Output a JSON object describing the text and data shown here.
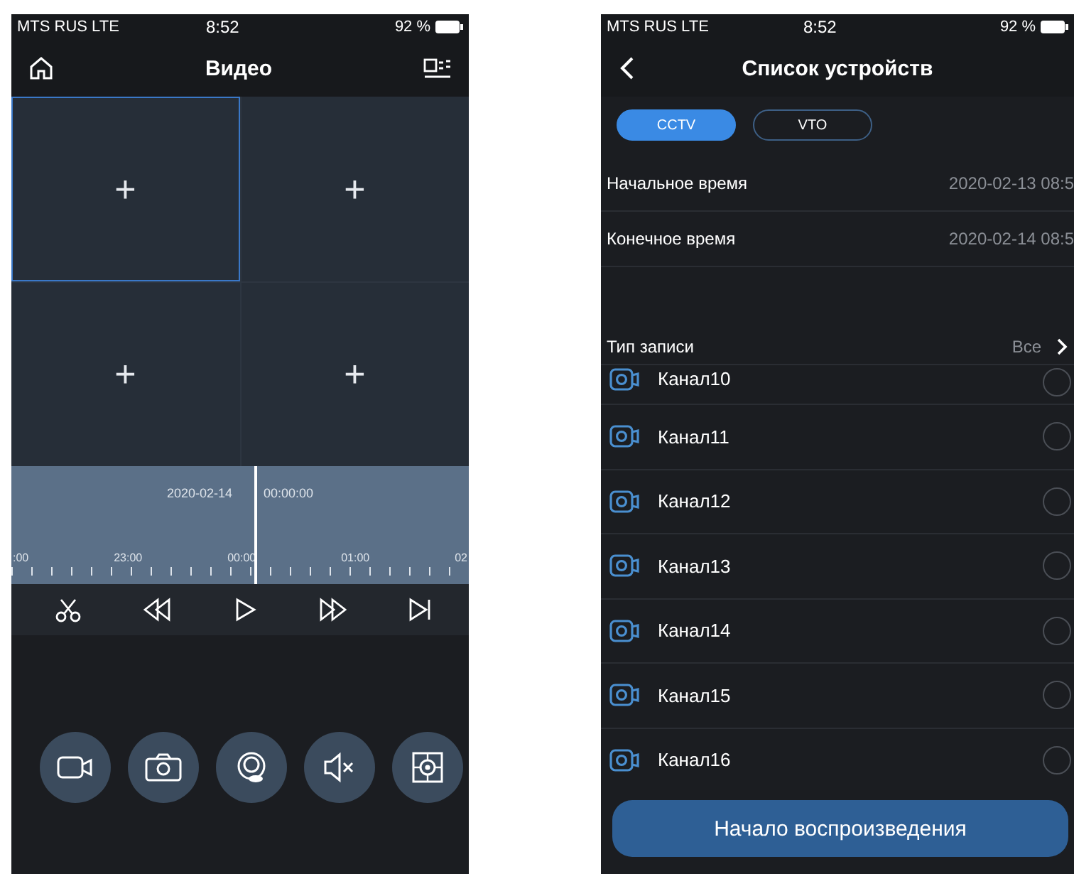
{
  "left_screen": {
    "status_bar": {
      "carrier": "MTS RUS  LTE",
      "time": "8:52",
      "battery": "92 %"
    },
    "header": {
      "title": "Видео"
    },
    "video_grid": [
      {
        "label": "+",
        "selected": true
      },
      {
        "label": "+",
        "selected": false
      },
      {
        "label": "+",
        "selected": false
      },
      {
        "label": "+",
        "selected": false
      }
    ],
    "timeline": {
      "date": "2020-02-14",
      "time": "00:00:00",
      "ticks": [
        ":00",
        "23:00",
        "00:00",
        "01:00",
        "02"
      ]
    },
    "playback_controls": [
      {
        "kind": "cut"
      },
      {
        "kind": "rewind"
      },
      {
        "kind": "play"
      },
      {
        "kind": "forward"
      },
      {
        "kind": "next"
      }
    ],
    "action_buttons": [
      {
        "kind": "record"
      },
      {
        "kind": "snapshot"
      },
      {
        "kind": "fisheye"
      },
      {
        "kind": "mute"
      },
      {
        "kind": "ptz"
      }
    ]
  },
  "right_screen": {
    "status_bar": {
      "carrier": "MTS RUS  LTE",
      "time": "8:52",
      "battery": "92 %"
    },
    "header": {
      "title": "Список устройств"
    },
    "tabs": [
      {
        "label": "CCTV",
        "selected": true
      },
      {
        "label": "VTO",
        "selected": false
      }
    ],
    "fields": [
      {
        "label": "Начальное время",
        "value": "2020-02-13 08:5"
      },
      {
        "label": "Конечное время",
        "value": "2020-02-14 08:5"
      }
    ],
    "record_type": {
      "label": "Тип записи",
      "value": "Все"
    },
    "channels": [
      {
        "name": "Канал10",
        "checked": false
      },
      {
        "name": "Канал11",
        "checked": false
      },
      {
        "name": "Канал12",
        "checked": false
      },
      {
        "name": "Канал13",
        "checked": false
      },
      {
        "name": "Канал14",
        "checked": false
      },
      {
        "name": "Канал15",
        "checked": false
      },
      {
        "name": "Канал16",
        "checked": false
      }
    ],
    "start_button": "Начало воспроизведения"
  }
}
